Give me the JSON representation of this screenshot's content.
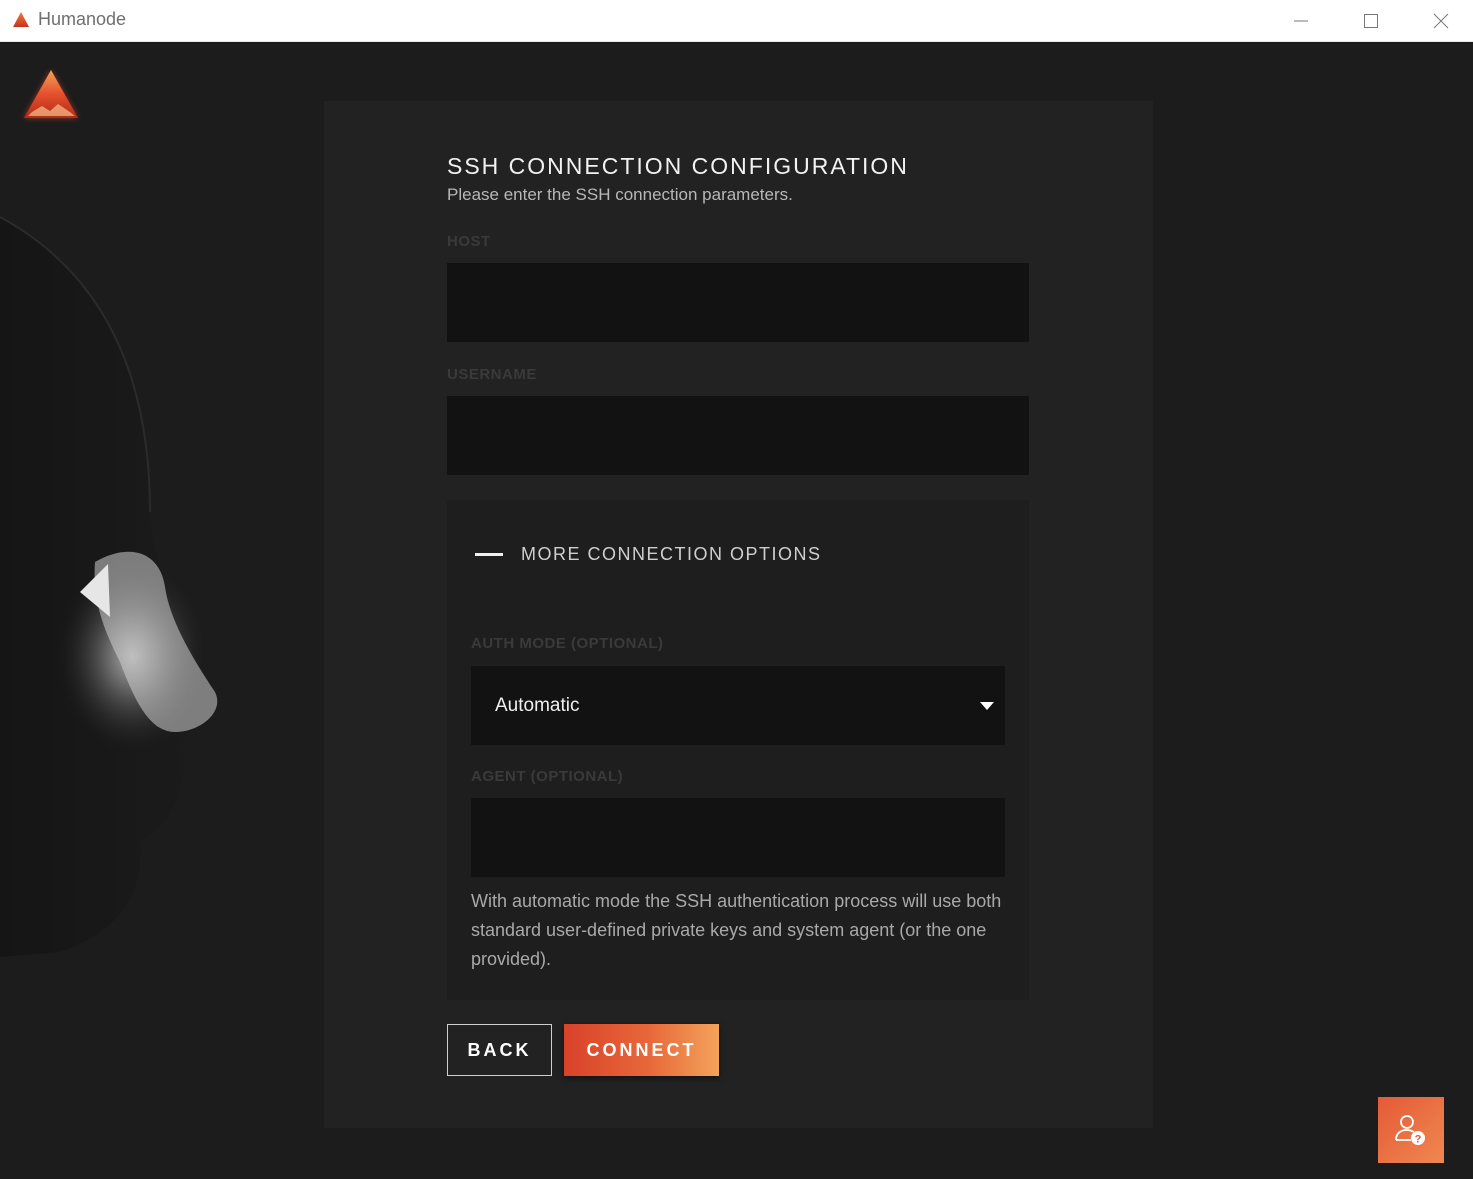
{
  "window": {
    "title": "Humanode"
  },
  "form": {
    "heading": "SSH CONNECTION CONFIGURATION",
    "subheading": "Please enter the SSH connection parameters.",
    "host_label": "HOST",
    "host_value": "",
    "username_label": "USERNAME",
    "username_value": ""
  },
  "options": {
    "toggle_label": "MORE CONNECTION OPTIONS",
    "auth_mode_label": "AUTH MODE (OPTIONAL)",
    "auth_mode_value": "Automatic",
    "agent_label": "AGENT (OPTIONAL)",
    "agent_value": "",
    "help_text": "With automatic mode the SSH authentication process will use both standard user-defined private keys and system agent (or the one provided)."
  },
  "actions": {
    "back_label": "BACK",
    "connect_label": "CONNECT"
  },
  "icons": {
    "app": "humanode-logo-icon",
    "toggle": "minus-icon",
    "select": "caret-down-icon",
    "help": "user-help-icon"
  },
  "colors": {
    "accent": "#e8683a",
    "panel": "#222222",
    "input": "#121212"
  }
}
